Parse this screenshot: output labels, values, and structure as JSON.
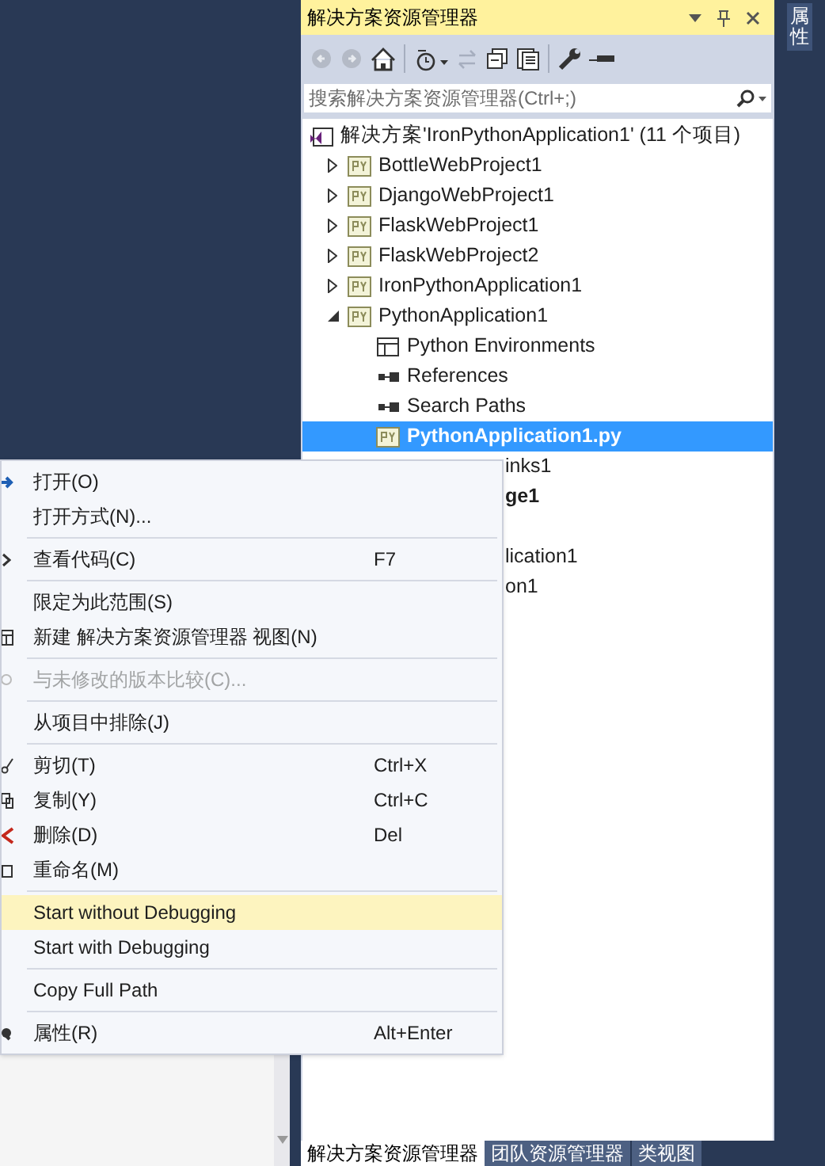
{
  "explorer": {
    "title": "解决方案资源管理器",
    "search": {
      "placeholder": "搜索解决方案资源管理器(Ctrl+;)"
    },
    "tree": [
      {
        "label": "解决方案'IronPythonApplication1' (11 个项目)",
        "kind": "solution",
        "selected": false,
        "children": [
          {
            "label": "BottleWebProject1",
            "kind": "project",
            "expanded": false,
            "selected": false
          },
          {
            "label": "DjangoWebProject1",
            "kind": "project",
            "expanded": false,
            "selected": false
          },
          {
            "label": "FlaskWebProject1",
            "kind": "project",
            "expanded": false,
            "selected": false
          },
          {
            "label": "FlaskWebProject2",
            "kind": "project",
            "expanded": false,
            "selected": false
          },
          {
            "label": "IronPythonApplication1",
            "kind": "project",
            "expanded": false,
            "selected": false
          },
          {
            "label": "PythonApplication1",
            "kind": "project",
            "expanded": true,
            "selected": false,
            "children": [
              {
                "label": "Python Environments",
                "kind": "environments",
                "selected": false
              },
              {
                "label": "References",
                "kind": "references",
                "selected": false
              },
              {
                "label": "Search Paths",
                "kind": "references",
                "selected": false
              },
              {
                "label": "PythonApplication1.py",
                "kind": "file",
                "selected": true
              }
            ]
          }
        ]
      }
    ],
    "clipped_rows": [
      {
        "text": "inks1",
        "bold": false
      },
      {
        "text": "ge1",
        "bold": true
      },
      {
        "kind": "blank"
      },
      {
        "text": "lication1",
        "bold": false
      },
      {
        "text": "on1",
        "bold": false
      }
    ],
    "bottom_tabs": [
      {
        "label": "解决方案资源管理器",
        "selected": true
      },
      {
        "label": "团队资源管理器",
        "selected": false
      },
      {
        "label": "类视图",
        "selected": false
      }
    ]
  },
  "side_tab": {
    "label": "属性"
  },
  "context_menu": {
    "groups": [
      [
        {
          "label": "打开(O)",
          "disabled": false,
          "selected": false
        },
        {
          "label": "打开方式(N)...",
          "disabled": false,
          "selected": false
        }
      ],
      [
        {
          "label": "查看代码(C)",
          "shortcut": "F7",
          "disabled": false,
          "selected": false
        }
      ],
      [
        {
          "label": "限定为此范围(S)",
          "disabled": false,
          "selected": false
        },
        {
          "label": "新建 解决方案资源管理器 视图(N)",
          "disabled": false,
          "selected": false
        }
      ],
      [
        {
          "label": "与未修改的版本比较(C)...",
          "disabled": true,
          "selected": false
        }
      ],
      [
        {
          "label": "从项目中排除(J)",
          "disabled": false,
          "selected": false
        }
      ],
      [
        {
          "label": "剪切(T)",
          "shortcut": "Ctrl+X",
          "disabled": false,
          "selected": false
        },
        {
          "label": "复制(Y)",
          "shortcut": "Ctrl+C",
          "disabled": false,
          "selected": false
        },
        {
          "label": "删除(D)",
          "shortcut": "Del",
          "disabled": false,
          "selected": false
        },
        {
          "label": "重命名(M)",
          "disabled": false,
          "selected": false
        }
      ],
      [
        {
          "label": "Start without Debugging",
          "disabled": false,
          "selected": true
        },
        {
          "label": "Start with Debugging",
          "disabled": false,
          "selected": false
        }
      ],
      [
        {
          "label": "Copy Full Path",
          "disabled": false,
          "selected": false
        }
      ],
      [
        {
          "label": "属性(R)",
          "shortcut": "Alt+Enter",
          "disabled": false,
          "selected": false
        }
      ]
    ]
  }
}
